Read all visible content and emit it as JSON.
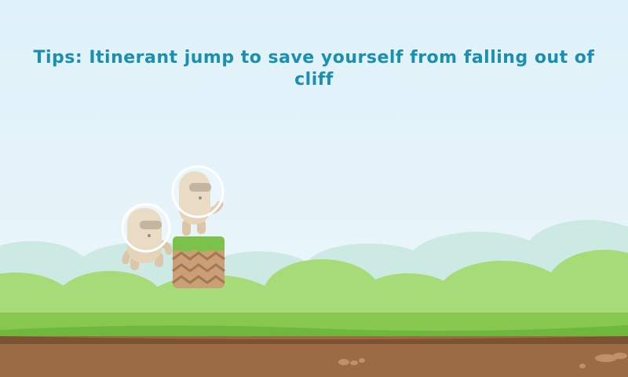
{
  "hud": {
    "tip_text": "Tips: Itinerant jump to save yourself from falling out of cliff"
  },
  "scene": {
    "sprites": [
      "astronaut-character",
      "astronaut-character",
      "grass-dirt-block"
    ],
    "colors": {
      "sky": "#e2f3fa",
      "far_hills": "#cfe9e6",
      "near_hills": "#9ad56a",
      "grass": "#7fc447",
      "dirt": "#9a6a45",
      "tip_text": "#1b8fb0"
    }
  }
}
